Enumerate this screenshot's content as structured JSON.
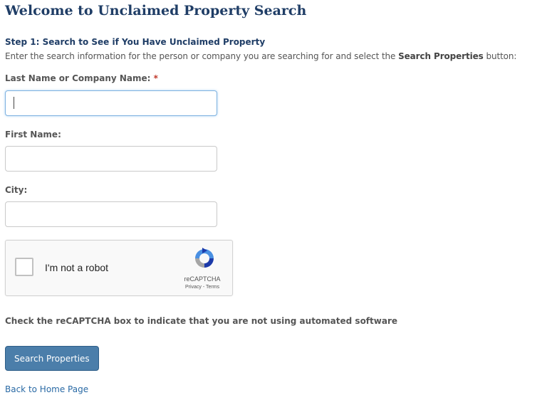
{
  "page": {
    "title": "Welcome to Unclaimed Property Search",
    "step_heading": "Step 1: Search to See if You Have Unclaimed Property",
    "instructions_before": "Enter the search information for the person or company you are searching for and select the ",
    "instructions_bold": "Search Properties",
    "instructions_after": " button:"
  },
  "form": {
    "last_name_label": "Last Name or Company Name:",
    "required_marker": "*",
    "last_name_value": "",
    "first_name_label": "First Name:",
    "first_name_value": "",
    "city_label": "City:",
    "city_value": ""
  },
  "recaptcha": {
    "checkbox_label": "I'm not a robot",
    "brand": "reCAPTCHA",
    "links": "Privacy - Terms",
    "checked": false,
    "logo_icon": "recaptcha-logo-icon"
  },
  "captcha_hint": "Check the reCAPTCHA box to indicate that you are not using automated software",
  "actions": {
    "search_button": "Search Properties",
    "back_link": "Back to Home Page"
  },
  "colors": {
    "heading": "#1f3d66",
    "button": "#4b7eaa",
    "link": "#2a6aa5",
    "required": "#c0392b"
  }
}
